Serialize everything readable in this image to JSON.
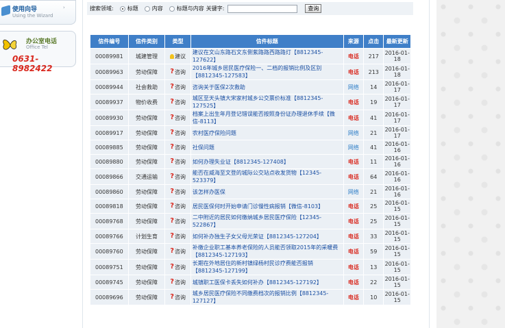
{
  "sidebar": {
    "guide": {
      "title": "使用向导",
      "subtitle": "Using the Wizard",
      "arrow": "›"
    },
    "tel": {
      "title": "办公室电话",
      "subtitle": "Office Tel",
      "number": "0631-8982422"
    }
  },
  "search": {
    "label": "搜索领域:",
    "opt_title": "标题",
    "opt_content": "内容",
    "opt_both": "标题与内容",
    "keyword_label": "关键字:",
    "keyword_value": "",
    "button": "查询"
  },
  "table": {
    "headers": [
      "信件编号",
      "信件类别",
      "类型",
      "信件标题",
      "来源",
      "点击",
      "最新更新"
    ],
    "rows": [
      {
        "id": "00089981",
        "cat": "城建管理",
        "type": "建议",
        "icon": "bulb",
        "title": "建议在文山东路石文东侧紫路路西路路灯【8812345-127622】",
        "src": "电话",
        "clicks": "217",
        "date": "2016-01-18"
      },
      {
        "id": "00089963",
        "cat": "劳动保障",
        "type": "咨询",
        "icon": "question",
        "title": "2016年城乡居民医疗保险一、二档的报销比例及区别【8812345-127583】",
        "src": "电话",
        "clicks": "213",
        "date": "2016-01-18"
      },
      {
        "id": "00089944",
        "cat": "社会救助",
        "type": "咨询",
        "icon": "question",
        "title": "咨询关于医保2次救助",
        "src": "网络",
        "clicks": "14",
        "date": "2016-01-17"
      },
      {
        "id": "00089937",
        "cat": "物价收费",
        "type": "咨询",
        "icon": "question",
        "title": "城区至天头镇大宋家村城乡公交票价标准【8812345-127525】",
        "src": "电话",
        "clicks": "19",
        "date": "2016-01-17"
      },
      {
        "id": "00089930",
        "cat": "劳动保障",
        "type": "咨询",
        "icon": "question",
        "title": "档案上出生年月登记错误能否按照身份证办理退休手续【微信-8113】",
        "src": "电话",
        "clicks": "41",
        "date": "2016-01-17"
      },
      {
        "id": "00089917",
        "cat": "劳动保障",
        "type": "咨询",
        "icon": "question",
        "title": "农村医疗保险问题",
        "src": "网络",
        "clicks": "21",
        "date": "2016-01-17"
      },
      {
        "id": "00089885",
        "cat": "劳动保障",
        "type": "咨询",
        "icon": "question",
        "title": "社保问题",
        "src": "网络",
        "clicks": "41",
        "date": "2016-01-16"
      },
      {
        "id": "00089880",
        "cat": "劳动保障",
        "type": "咨询",
        "icon": "question",
        "title": "如何办理失业证【8812345-127408】",
        "src": "电话",
        "clicks": "11",
        "date": "2016-01-16"
      },
      {
        "id": "00089866",
        "cat": "交通运输",
        "type": "咨询",
        "icon": "question",
        "title": "能否在威海至文登的城际公交站点收发货物【12345-523379】",
        "src": "电话",
        "clicks": "64",
        "date": "2016-01-16"
      },
      {
        "id": "00089860",
        "cat": "劳动保障",
        "type": "咨询",
        "icon": "question",
        "title": "该怎样办医保",
        "src": "网络",
        "clicks": "21",
        "date": "2016-01-16"
      },
      {
        "id": "00089818",
        "cat": "劳动保障",
        "type": "咨询",
        "icon": "question",
        "title": "居民医保何时开始申请门诊慢性病报销【微信-8103】",
        "src": "电话",
        "clicks": "25",
        "date": "2016-01-15"
      },
      {
        "id": "00089768",
        "cat": "劳动保障",
        "type": "咨询",
        "icon": "question",
        "title": "二中附近的居民如何缴纳城乡居民医疗保险【12345-522867】",
        "src": "电话",
        "clicks": "25",
        "date": "2016-01-15"
      },
      {
        "id": "00089766",
        "cat": "计划生育",
        "type": "咨询",
        "icon": "question",
        "title": "如何补办独生子女父母光荣证【8812345-127204】",
        "src": "电话",
        "clicks": "33",
        "date": "2016-01-15"
      },
      {
        "id": "00089760",
        "cat": "劳动保障",
        "type": "咨询",
        "icon": "question",
        "title": "补缴企业职工基本养老保险的人员能否领取2015年的采暖费【8812345-127193】",
        "src": "电话",
        "clicks": "59",
        "date": "2016-01-15"
      },
      {
        "id": "00089751",
        "cat": "劳动保障",
        "type": "咨询",
        "icon": "question",
        "title": "长期在外地居住的新村镇绿杨村民诊疗费能否报销【8812345-127199】",
        "src": "电话",
        "clicks": "13",
        "date": "2016-01-15"
      },
      {
        "id": "00089745",
        "cat": "劳动保障",
        "type": "咨询",
        "icon": "question",
        "title": "城镇职工医保卡丢失如何补办【8812345-127192】",
        "src": "电话",
        "clicks": "22",
        "date": "2016-01-15"
      },
      {
        "id": "00089696",
        "cat": "劳动保障",
        "type": "咨询",
        "icon": "question",
        "title": "城乡居民医疗保险不同缴费档次的报销比例【8812345-127127】",
        "src": "电话",
        "clicks": "10",
        "date": "2016-01-15"
      }
    ]
  },
  "colors": {
    "header_bg": "#3f7fc8",
    "row_bg": "#ebf0f5",
    "tel_red": "#d9281e",
    "web_blue": "#2e7ec7",
    "title_blue": "#1a4fa3"
  },
  "icons": {
    "question": "question-mark-icon",
    "bulb": "lightbulb-icon",
    "wizard": "wizard-icon",
    "butterfly": "butterfly-icon"
  }
}
